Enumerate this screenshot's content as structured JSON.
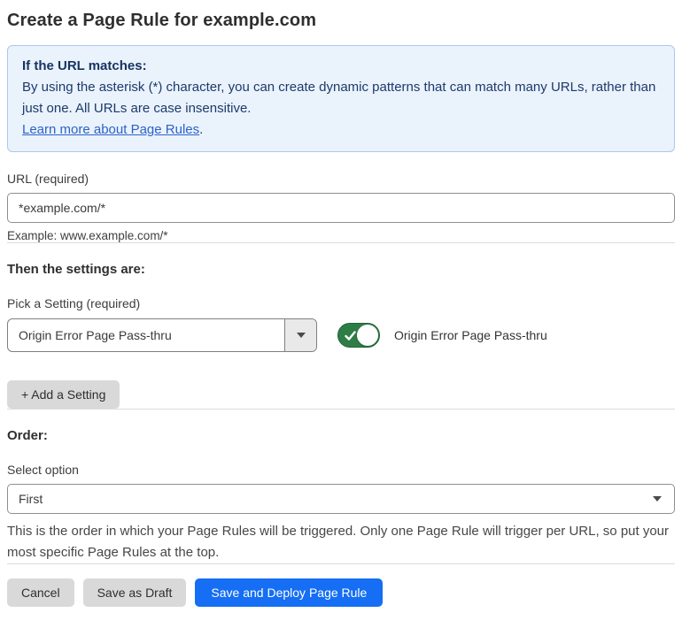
{
  "page": {
    "title": "Create a Page Rule for example.com"
  },
  "info_box": {
    "heading": "If the URL matches:",
    "body": "By using the asterisk (*) character, you can create dynamic patterns that can match many URLs, rather than just one. All URLs are case insensitive.",
    "link_label": "Learn more about Page Rules",
    "link_suffix": "."
  },
  "url_field": {
    "label": "URL (required)",
    "value": "*example.com/*",
    "example": "Example: www.example.com/*"
  },
  "settings_section": {
    "heading": "Then the settings are:",
    "picker_label": "Pick a Setting (required)",
    "picker_value": "Origin Error Page Pass-thru",
    "toggle_state": "on",
    "toggle_label": "Origin Error Page Pass-thru",
    "add_setting_label": "+ Add a Setting"
  },
  "order_section": {
    "heading": "Order:",
    "select_label": "Select option",
    "select_value": "First",
    "help_text": "This is the order in which your Page Rules will be triggered. Only one Page Rule will trigger per URL, so put your most specific Page Rules at the top."
  },
  "footer": {
    "cancel_label": "Cancel",
    "save_draft_label": "Save as Draft",
    "save_deploy_label": "Save and Deploy Page Rule"
  },
  "colors": {
    "info_bg": "#eaf2fc",
    "info_border": "#a9c9ee",
    "info_text": "#1c3a6b",
    "link_blue": "#2c63c8",
    "toggle_green": "#2e7d46",
    "primary_blue": "#156ef3",
    "secondary_gray": "#d9d9d9"
  }
}
